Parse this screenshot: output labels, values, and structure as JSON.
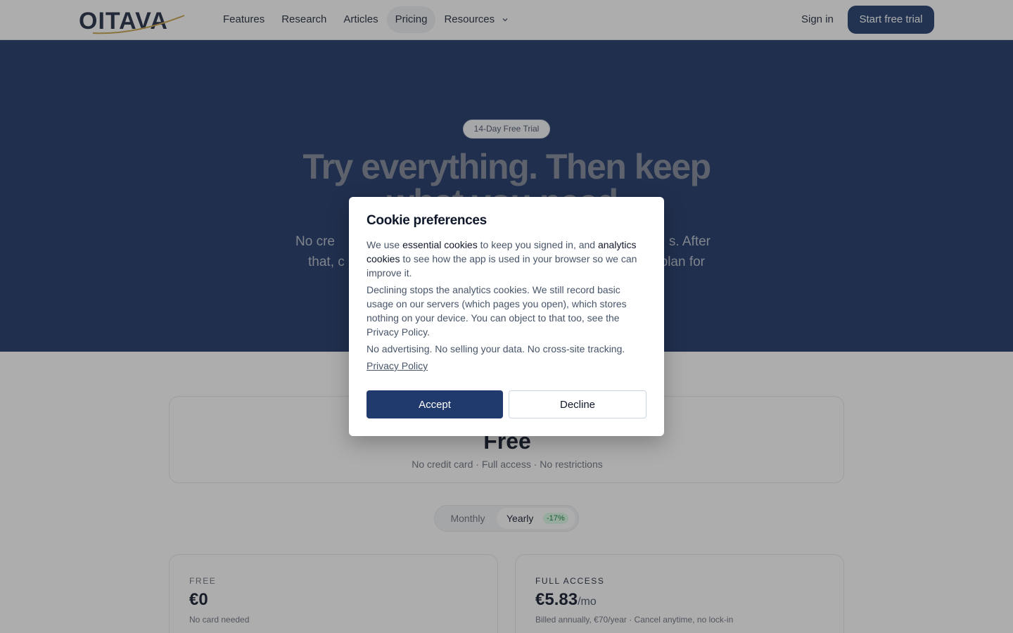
{
  "nav": {
    "logo_text": "OITAVA",
    "links": [
      {
        "label": "Features"
      },
      {
        "label": "Research"
      },
      {
        "label": "Articles"
      },
      {
        "label": "Pricing",
        "active": true
      },
      {
        "label": "Resources"
      }
    ],
    "sign_in": "Sign in",
    "cta": "Start free trial"
  },
  "hero": {
    "pill": "14-Day Free Trial",
    "title_line1": "Try everything. Then keep",
    "title_line2": "what you need.",
    "subtitle_left_1": "No cre",
    "subtitle_right_1": "s. After",
    "subtitle_left_2": "that, c",
    "subtitle_right_2": "plan for"
  },
  "pricing": {
    "band_title": "Free",
    "band_subtitle": "No credit card · Full access · No restrictions",
    "toggle": {
      "monthly": "Monthly",
      "yearly": "Yearly",
      "save_badge": "-17%",
      "selected": "Yearly"
    },
    "plans": [
      {
        "tag": "FREE",
        "price": "€0",
        "per": "",
        "note": "No card needed"
      },
      {
        "tag": "FULL ACCESS",
        "price": "€5.83",
        "per": "/mo",
        "note": "Billed annually, €70/year · Cancel anytime, no lock-in"
      }
    ]
  },
  "cookie": {
    "title": "Cookie preferences",
    "p1_a": "We use ",
    "p1_b": "essential cookies",
    "p1_c": " to keep you signed in, and ",
    "p1_d": "analytics cookies",
    "p1_e": " to see how the app is used in your browser so we can improve it.",
    "p2": "Declining stops the analytics cookies. We still record basic usage on our servers (which pages you open), which stores nothing on your device. You can object to that too, see the Privacy Policy.",
    "p3": "No advertising. No selling your data. No cross-site tracking.",
    "privacy_link": "Privacy Policy",
    "accept": "Accept",
    "decline": "Decline"
  },
  "colors": {
    "primary": "#213a6e",
    "hero_bg": "#1c3466",
    "logo_gold": "#c9a44a",
    "badge_green": "#15803d"
  }
}
